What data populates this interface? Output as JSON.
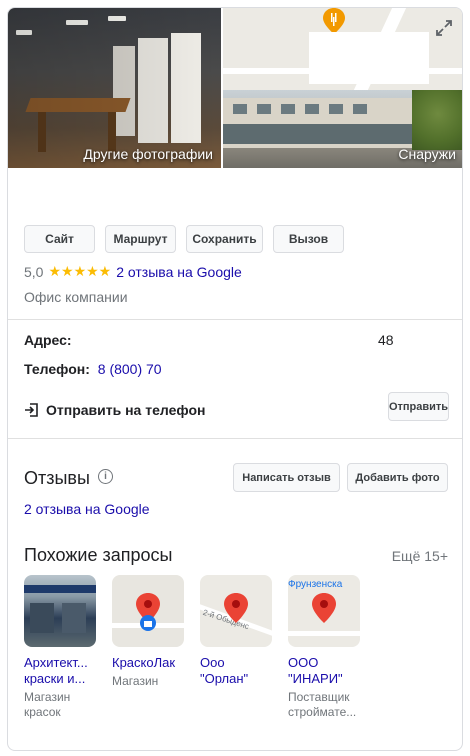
{
  "photos": {
    "left_caption": "Другие фотографии",
    "right_caption": "Снаружи"
  },
  "actions": {
    "site": "Сайт",
    "route": "Маршрут",
    "save": "Сохранить",
    "call": "Вызов"
  },
  "rating": {
    "value": "5,0",
    "stars": "★★★★★",
    "reviews_link": "2 отзыва на Google"
  },
  "category": "Офис компании",
  "address": {
    "label": "Адрес:",
    "value_suffix": "48"
  },
  "phone": {
    "label": "Телефон:",
    "value": "8 (800) 70"
  },
  "send_to_phone": {
    "label": "Отправить на телефон",
    "button": "Отправить"
  },
  "reviews": {
    "title": "Отзывы",
    "info": "i",
    "write_button": "Написать отзыв",
    "add_photo_button": "Добавить фото",
    "link": "2 отзыва на Google"
  },
  "similar": {
    "title": "Похожие запросы",
    "more": "Ещё 15+",
    "items": [
      {
        "name1": "Архитект...",
        "name2": "краски и...",
        "sub1": "Магазин",
        "sub2": "красок"
      },
      {
        "name1": "КраскоЛак",
        "name2": "",
        "sub1": "Магазин",
        "sub2": ""
      },
      {
        "name1": "Ооо",
        "name2": "\"Орлан\"",
        "sub1": "",
        "sub2": ""
      },
      {
        "name1": "ООО",
        "name2": "\"ИНАРИ\"",
        "sub1": "Поставщик",
        "sub2": "строймате..."
      }
    ],
    "map_labels": {
      "item3_street": "2-й Обыденс",
      "item4_area": "Фрунзенска"
    }
  },
  "colors": {
    "link": "#1a0dab",
    "star": "#fbbc04",
    "pin": "#ea4335"
  }
}
